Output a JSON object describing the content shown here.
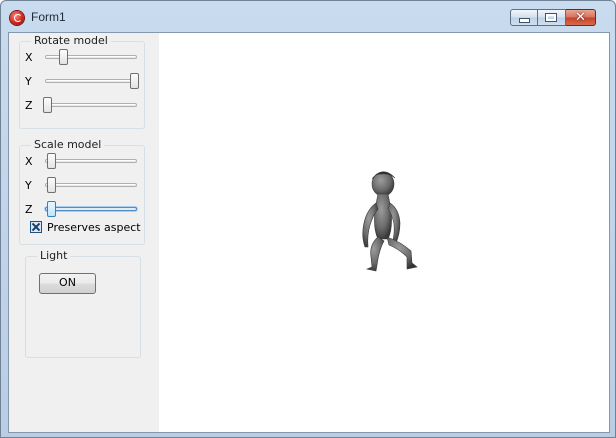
{
  "window": {
    "title": "Form1",
    "icon": "app-logo-icon",
    "controls": {
      "minimize": "minimize-icon",
      "maximize": "maximize-icon",
      "close_glyph": "✕"
    }
  },
  "rotate_model": {
    "title": "Rotate model",
    "axes": [
      {
        "label": "X",
        "value_fraction": 0.18
      },
      {
        "label": "Y",
        "value_fraction": 1.0
      },
      {
        "label": "Z",
        "value_fraction": 0.0
      }
    ]
  },
  "scale_model": {
    "title": "Scale model",
    "axes": [
      {
        "label": "X",
        "value_fraction": 0.05
      },
      {
        "label": "Y",
        "value_fraction": 0.05
      },
      {
        "label": "Z",
        "value_fraction": 0.05
      }
    ],
    "preserves_aspect": {
      "label": "Preserves aspect",
      "checked": true
    }
  },
  "light": {
    "title": "Light",
    "button_label": "ON"
  },
  "viewport": {
    "model_icon": "3d-figure-icon"
  },
  "colors": {
    "titlebar": "#c9dbee",
    "panel": "#f0f0f0",
    "viewport": "#ffffff",
    "model": "#6a6a6a"
  }
}
